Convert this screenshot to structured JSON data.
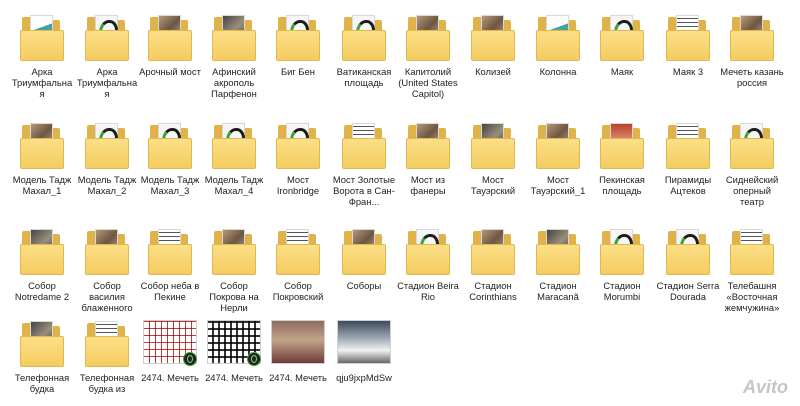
{
  "items": [
    {
      "label": "Арка Триумфальная",
      "kind": "folder",
      "preview": "p-green"
    },
    {
      "label": "Арка Триумфальная",
      "kind": "folder",
      "preview": "p-swirl"
    },
    {
      "label": "Арочный мост",
      "kind": "folder",
      "preview": "p-photo"
    },
    {
      "label": "Афинский акрополь Парфенон",
      "kind": "folder",
      "preview": "p-dark"
    },
    {
      "label": "Биг Бен",
      "kind": "folder",
      "preview": "p-swirl"
    },
    {
      "label": "Ватиканская площадь",
      "kind": "folder",
      "preview": "p-swirl"
    },
    {
      "label": "Капитолий (United States Capitol)",
      "kind": "folder",
      "preview": "p-photo"
    },
    {
      "label": "Колизей",
      "kind": "folder",
      "preview": "p-photo"
    },
    {
      "label": "Колонна",
      "kind": "folder",
      "preview": "p-green"
    },
    {
      "label": "Маяк",
      "kind": "folder",
      "preview": "p-swirl"
    },
    {
      "label": "Маяк 3",
      "kind": "folder",
      "preview": "p-plan"
    },
    {
      "label": "Мечеть казань россия",
      "kind": "folder",
      "preview": "p-photo"
    },
    {
      "label": "Модель Тадж Махал_1",
      "kind": "folder",
      "preview": "p-photo"
    },
    {
      "label": "Модель Тадж Махал_2",
      "kind": "folder",
      "preview": "p-swirl"
    },
    {
      "label": "Модель Тадж Махал_3",
      "kind": "folder",
      "preview": "p-swirl"
    },
    {
      "label": "Модель Тадж Махал_4",
      "kind": "folder",
      "preview": "p-swirl"
    },
    {
      "label": "Мост Ironbridge",
      "kind": "folder",
      "preview": "p-swirl"
    },
    {
      "label": "Мост Золотые Ворота в Сан-Фран...",
      "kind": "folder",
      "preview": "p-plan"
    },
    {
      "label": "Мост из фанеры",
      "kind": "folder",
      "preview": "p-photo"
    },
    {
      "label": "Мост Тауэрский",
      "kind": "folder",
      "preview": "p-dark"
    },
    {
      "label": "Мост Тауэрский_1",
      "kind": "folder",
      "preview": "p-photo"
    },
    {
      "label": "Пекинская площадь",
      "kind": "folder",
      "preview": "p-red"
    },
    {
      "label": "Пирамиды Ацтеков",
      "kind": "folder",
      "preview": "p-plan"
    },
    {
      "label": "Сиднейский оперный театр",
      "kind": "folder",
      "preview": "p-swirl"
    },
    {
      "label": "Собор Notredame 2",
      "kind": "folder",
      "preview": "p-dark"
    },
    {
      "label": "Собор василия блаженного",
      "kind": "folder",
      "preview": "p-photo"
    },
    {
      "label": "Собор неба в Пекине",
      "kind": "folder",
      "preview": "p-plan"
    },
    {
      "label": "Собор Покрова на Нерли",
      "kind": "folder",
      "preview": "p-photo"
    },
    {
      "label": "Собор Покровский",
      "kind": "folder",
      "preview": "p-plan"
    },
    {
      "label": "Соборы",
      "kind": "folder",
      "preview": "p-photo"
    },
    {
      "label": "Стадион Beira Rio",
      "kind": "folder",
      "preview": "p-swirl"
    },
    {
      "label": "Стадион Corinthians",
      "kind": "folder",
      "preview": "p-photo"
    },
    {
      "label": "Стадион Maracanã",
      "kind": "folder",
      "preview": "p-dark"
    },
    {
      "label": "Стадион Morumbi",
      "kind": "folder",
      "preview": "p-swirl"
    },
    {
      "label": "Стадион Serra Dourada",
      "kind": "folder",
      "preview": "p-swirl"
    },
    {
      "label": "Телебашня «Восточная жемчужина»",
      "kind": "folder",
      "preview": "p-plan"
    },
    {
      "label": "Телефонная будка",
      "kind": "folder",
      "preview": "p-dark"
    },
    {
      "label": "Телефонная будка из",
      "kind": "folder",
      "preview": "p-plan"
    },
    {
      "label": "2474. Мечеть",
      "kind": "image",
      "preview": "img-plan-red",
      "badge": true
    },
    {
      "label": "2474. Мечеть",
      "kind": "image",
      "preview": "img-plan-dark",
      "badge": true
    },
    {
      "label": "2474. Мечеть",
      "kind": "image",
      "preview": "img-photo-room",
      "badge": false
    },
    {
      "label": "qju9jxpMdSw",
      "kind": "image",
      "preview": "img-photo-model",
      "badge": false
    }
  ],
  "watermark": "Avito"
}
